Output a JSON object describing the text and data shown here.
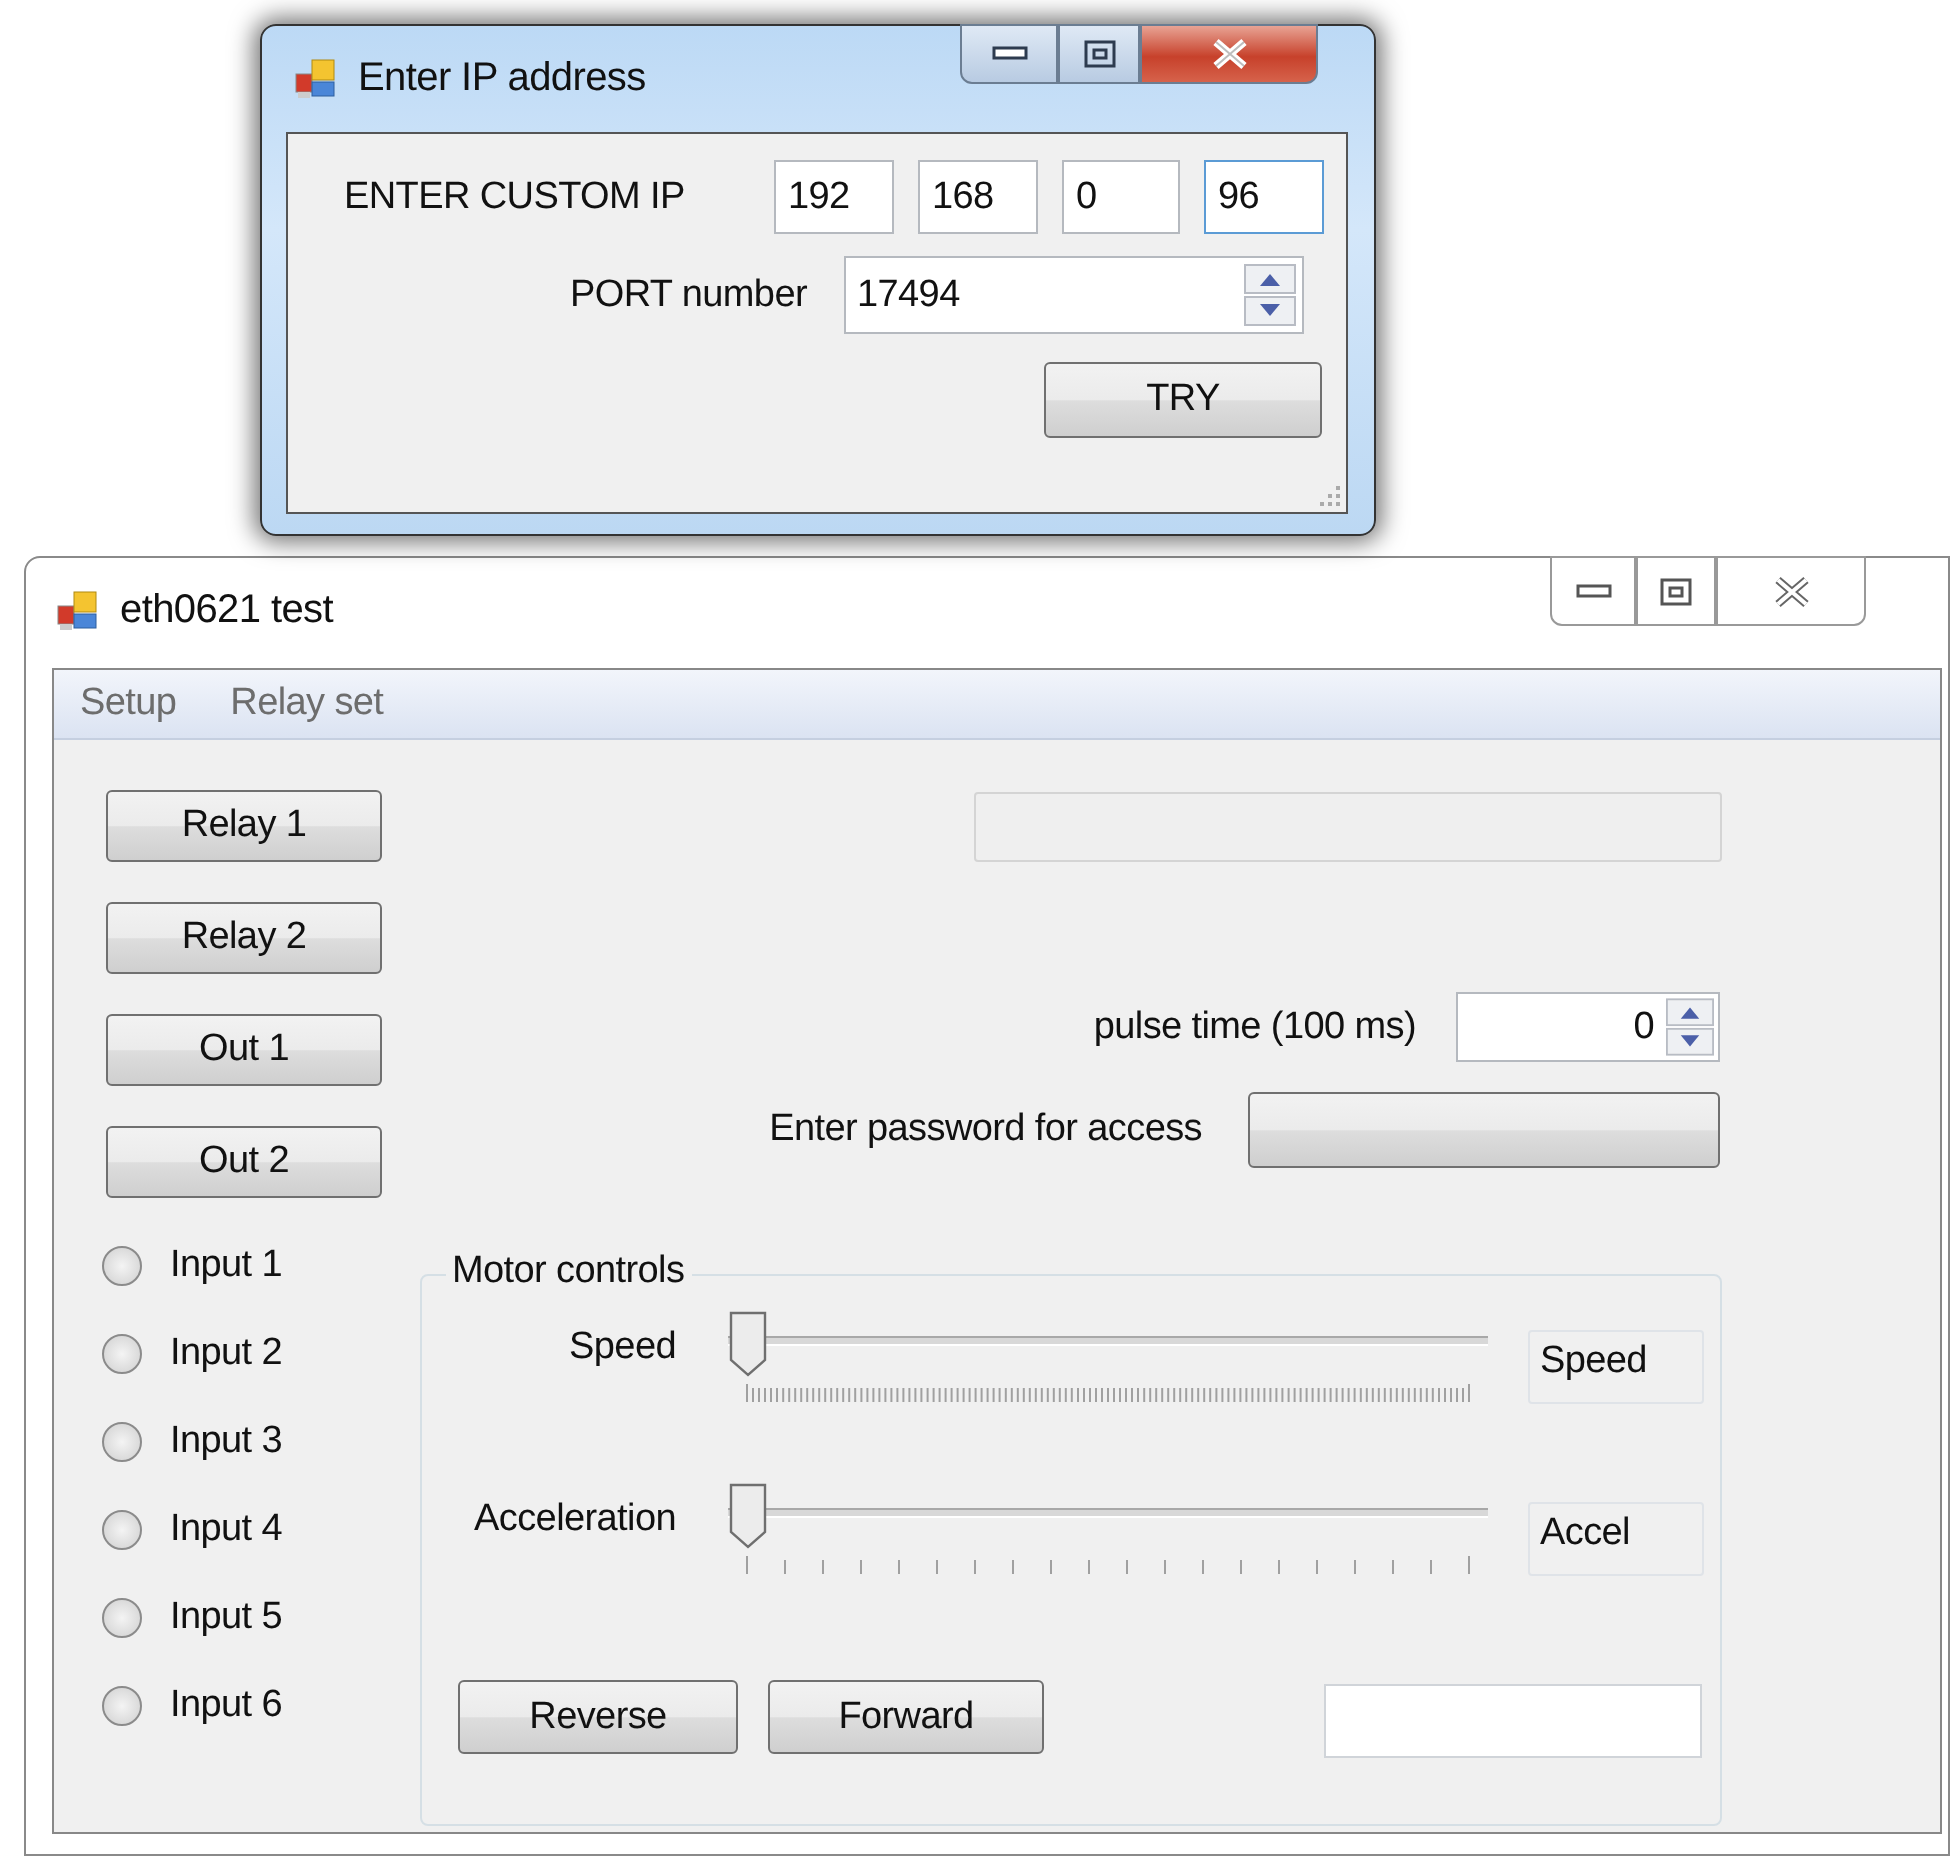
{
  "dialog": {
    "title": "Enter IP address",
    "ip_label": "ENTER CUSTOM IP",
    "ip_octets": [
      {
        "value": "192",
        "focused": false
      },
      {
        "value": "168",
        "focused": false
      },
      {
        "value": "0",
        "focused": false
      },
      {
        "value": "96",
        "focused": true
      }
    ],
    "port_label": "PORT number",
    "port_value": "17494",
    "try_button": "TRY"
  },
  "main_window": {
    "title": "eth0621 test",
    "menu": [
      "Setup",
      "Relay set"
    ],
    "buttons": [
      "Relay 1",
      "Relay 2",
      "Out 1",
      "Out 2"
    ],
    "inputs": [
      {
        "label": "Input 1",
        "checked": false
      },
      {
        "label": "Input 2",
        "checked": false
      },
      {
        "label": "Input 3",
        "checked": false
      },
      {
        "label": "Input 4",
        "checked": false
      },
      {
        "label": "Input 5",
        "checked": false
      },
      {
        "label": "Input 6",
        "checked": false
      }
    ],
    "pulse_label": "pulse time (100 ms)",
    "pulse_value": "0",
    "password_label": "Enter password for access",
    "motor": {
      "title": "Motor controls",
      "sliders": [
        {
          "label": "Speed",
          "level": 0,
          "readout": "Speed",
          "kind": "fine"
        },
        {
          "label": "Acceleration",
          "level": 0,
          "readout": "Accel",
          "kind": "coarse"
        }
      ],
      "reverse_button": "Reverse",
      "forward_button": "Forward"
    }
  }
}
